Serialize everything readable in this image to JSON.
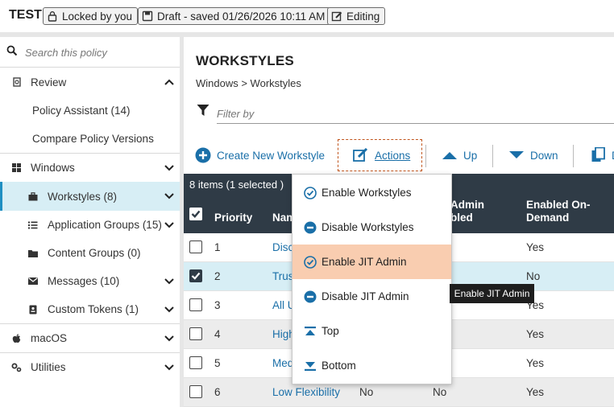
{
  "topbar": {
    "title": "TEST",
    "locked": "Locked by you",
    "draft": "Draft - saved 01/26/2026 10:11 AM",
    "editing": "Editing"
  },
  "sidebar": {
    "search_placeholder": "Search this policy",
    "review": {
      "label": "Review",
      "items": [
        "Policy Assistant (14)",
        "Compare Policy Versions"
      ]
    },
    "windows": {
      "label": "Windows",
      "items": [
        {
          "label": "Workstyles (8)",
          "active": true
        },
        {
          "label": "Application Groups (15)"
        },
        {
          "label": "Content Groups (0)"
        },
        {
          "label": "Messages (10)"
        },
        {
          "label": "Custom Tokens (1)"
        }
      ]
    },
    "macos": "macOS",
    "utilities": "Utilities"
  },
  "main": {
    "heading": "WORKSTYLES",
    "breadcrumb": "Windows > Workstyles",
    "filter_placeholder": "Filter by",
    "toolbar": {
      "create": "Create New Workstyle",
      "actions": "Actions",
      "up": "Up",
      "down": "Down",
      "partial": "D"
    },
    "table": {
      "count": "8 items (1 selected )",
      "headers": {
        "priority": "Priority",
        "name": "Nam",
        "admin": "Admin\nbled",
        "ondemand": "Enabled On-\nDemand"
      },
      "rows": [
        {
          "priority": "1",
          "name": "Disc",
          "col3": "",
          "col4": "",
          "ondemand": "Yes",
          "checked": false,
          "selected": false
        },
        {
          "priority": "2",
          "name": "Trus",
          "col3": "",
          "col4": "",
          "ondemand": "No",
          "checked": true,
          "selected": true
        },
        {
          "priority": "3",
          "name": "All U",
          "col3": "",
          "col4": "",
          "ondemand": "Yes",
          "checked": false,
          "selected": false
        },
        {
          "priority": "4",
          "name": "High",
          "col3": "",
          "col4": "",
          "ondemand": "Yes",
          "checked": false,
          "selected": false
        },
        {
          "priority": "5",
          "name": "Med",
          "col3": "",
          "col4": "",
          "ondemand": "Yes",
          "checked": false,
          "selected": false
        },
        {
          "priority": "6",
          "name": "Low Flexibility",
          "col3": "No",
          "col4": "No",
          "ondemand": "Yes",
          "checked": false,
          "selected": false
        }
      ]
    }
  },
  "menu": {
    "items": [
      "Enable Workstyles",
      "Disable Workstyles",
      "Enable JIT Admin",
      "Disable JIT Admin",
      "Top",
      "Bottom"
    ],
    "highlighted_index": 2
  },
  "tooltip": "Enable JIT Admin",
  "colors": {
    "accent": "#1a6fa8",
    "header": "#2f3b46",
    "selected_row": "#d7eef5",
    "menu_highlight": "#f9cdb0"
  }
}
